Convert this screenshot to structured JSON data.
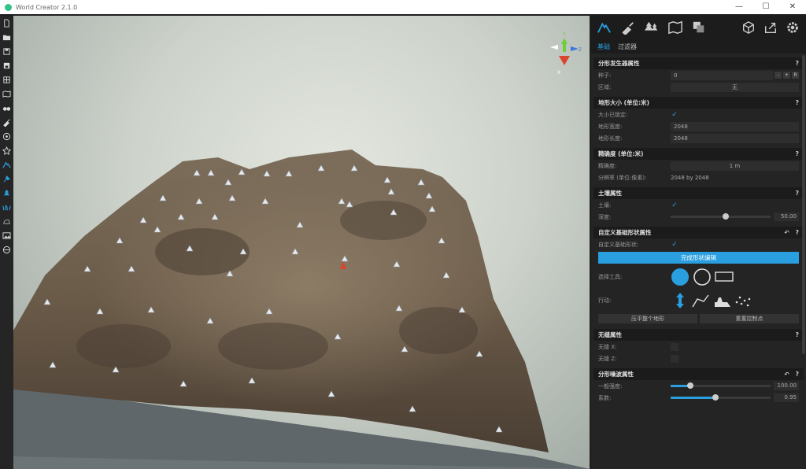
{
  "window": {
    "title": "World Creator 2.1.0",
    "minimize": "—",
    "maximize": "☐",
    "close": "✕"
  },
  "left_tools": [
    "new-file-icon",
    "open-folder-icon",
    "save-icon",
    "save-as-icon",
    "export-icon",
    "map-icon",
    "binoculars-icon",
    "brush-icon",
    "target-icon",
    "star-icon",
    "mountain-icon",
    "pin-icon",
    "tree-icon",
    "grass-icon",
    "rock-icon",
    "image-icon",
    "globe-icon"
  ],
  "gizmo": {
    "x": "X",
    "y": "Y",
    "z": "Z"
  },
  "panel": {
    "tabs": [
      {
        "label": "基础",
        "active": true
      },
      {
        "label": "过滤器",
        "active": false
      }
    ],
    "fractal": {
      "title": "分形发生器属性",
      "help": "?",
      "seed_label": "种子:",
      "seed_value": "0",
      "minus": "-",
      "plus": "+",
      "reset": "R",
      "region_label": "区域:",
      "region_value": "无"
    },
    "size": {
      "title": "地形大小 (单位:米)",
      "help": "?",
      "locked_label": "大小已锁定:",
      "width_label": "地形宽度:",
      "width_value": "2048",
      "length_label": "地形长度:",
      "length_value": "2048"
    },
    "precision": {
      "title": "精确度 (单位:米)",
      "help": "?",
      "prec_label": "精确度:",
      "prec_value": "1 m",
      "res_label": "分辨率 (单位:像素):",
      "res_value": "2048 by 2048"
    },
    "soil": {
      "title": "土壤属性",
      "help": "?",
      "soil_label": "土壤:",
      "depth_label": "深度:",
      "depth_value": "50.00",
      "depth_fraction": 0.55
    },
    "custom": {
      "title": "自定义基础形状属性",
      "undo": "↶",
      "help": "?",
      "custom_label": "自定义基础形状:",
      "finish_button": "完成形状编辑",
      "tool_label": "选择工具:",
      "action_label": "行动:",
      "flatten_button": "压平整个地形",
      "reset_button": "重置控制点"
    },
    "seamless": {
      "title": "无缝属性",
      "help": "?",
      "x_label": "无缝 X:",
      "z_label": "无缝 Z:"
    },
    "noise": {
      "title": "分形噪波属性",
      "undo": "↶",
      "help": "?",
      "strength_label": "一般强度:",
      "strength_value": "100.00",
      "strength_fraction": 0.2,
      "factor_label": "系数:",
      "factor_value": "0.95",
      "factor_fraction": 0.45
    }
  },
  "colors": {
    "accent": "#2a9fe0",
    "panel_bg": "#242424"
  }
}
